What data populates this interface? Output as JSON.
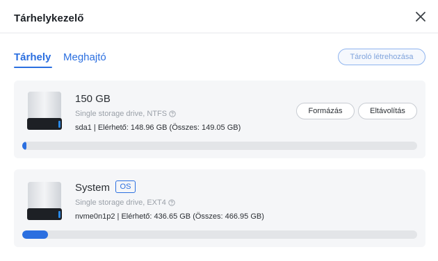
{
  "dialog": {
    "title": "Tárhelykezelő"
  },
  "tabs": [
    {
      "label": "Tárhely",
      "active": true
    },
    {
      "label": "Meghajtó",
      "active": false
    }
  ],
  "toolbar": {
    "create_label": "Tároló létrehozása"
  },
  "drives": [
    {
      "name": "150 GB",
      "type": "Single storage drive, NTFS",
      "details": "sda1 | Elérhető: 148.96 GB (Összes: 149.05 GB)",
      "used_fraction": 0.0006,
      "actions": {
        "format": "Formázás",
        "remove": "Eltávolítás"
      }
    },
    {
      "name": "System",
      "badge": "OS",
      "type": "Single storage drive, EXT4",
      "details": "nvme0n1p2 | Elérhető: 436.65 GB (Összes: 466.95 GB)",
      "used_fraction": 0.065
    }
  ],
  "colors": {
    "accent": "#2b6fe0",
    "card_bg": "#f5f6f8",
    "progress_track": "#e3e5e8"
  }
}
